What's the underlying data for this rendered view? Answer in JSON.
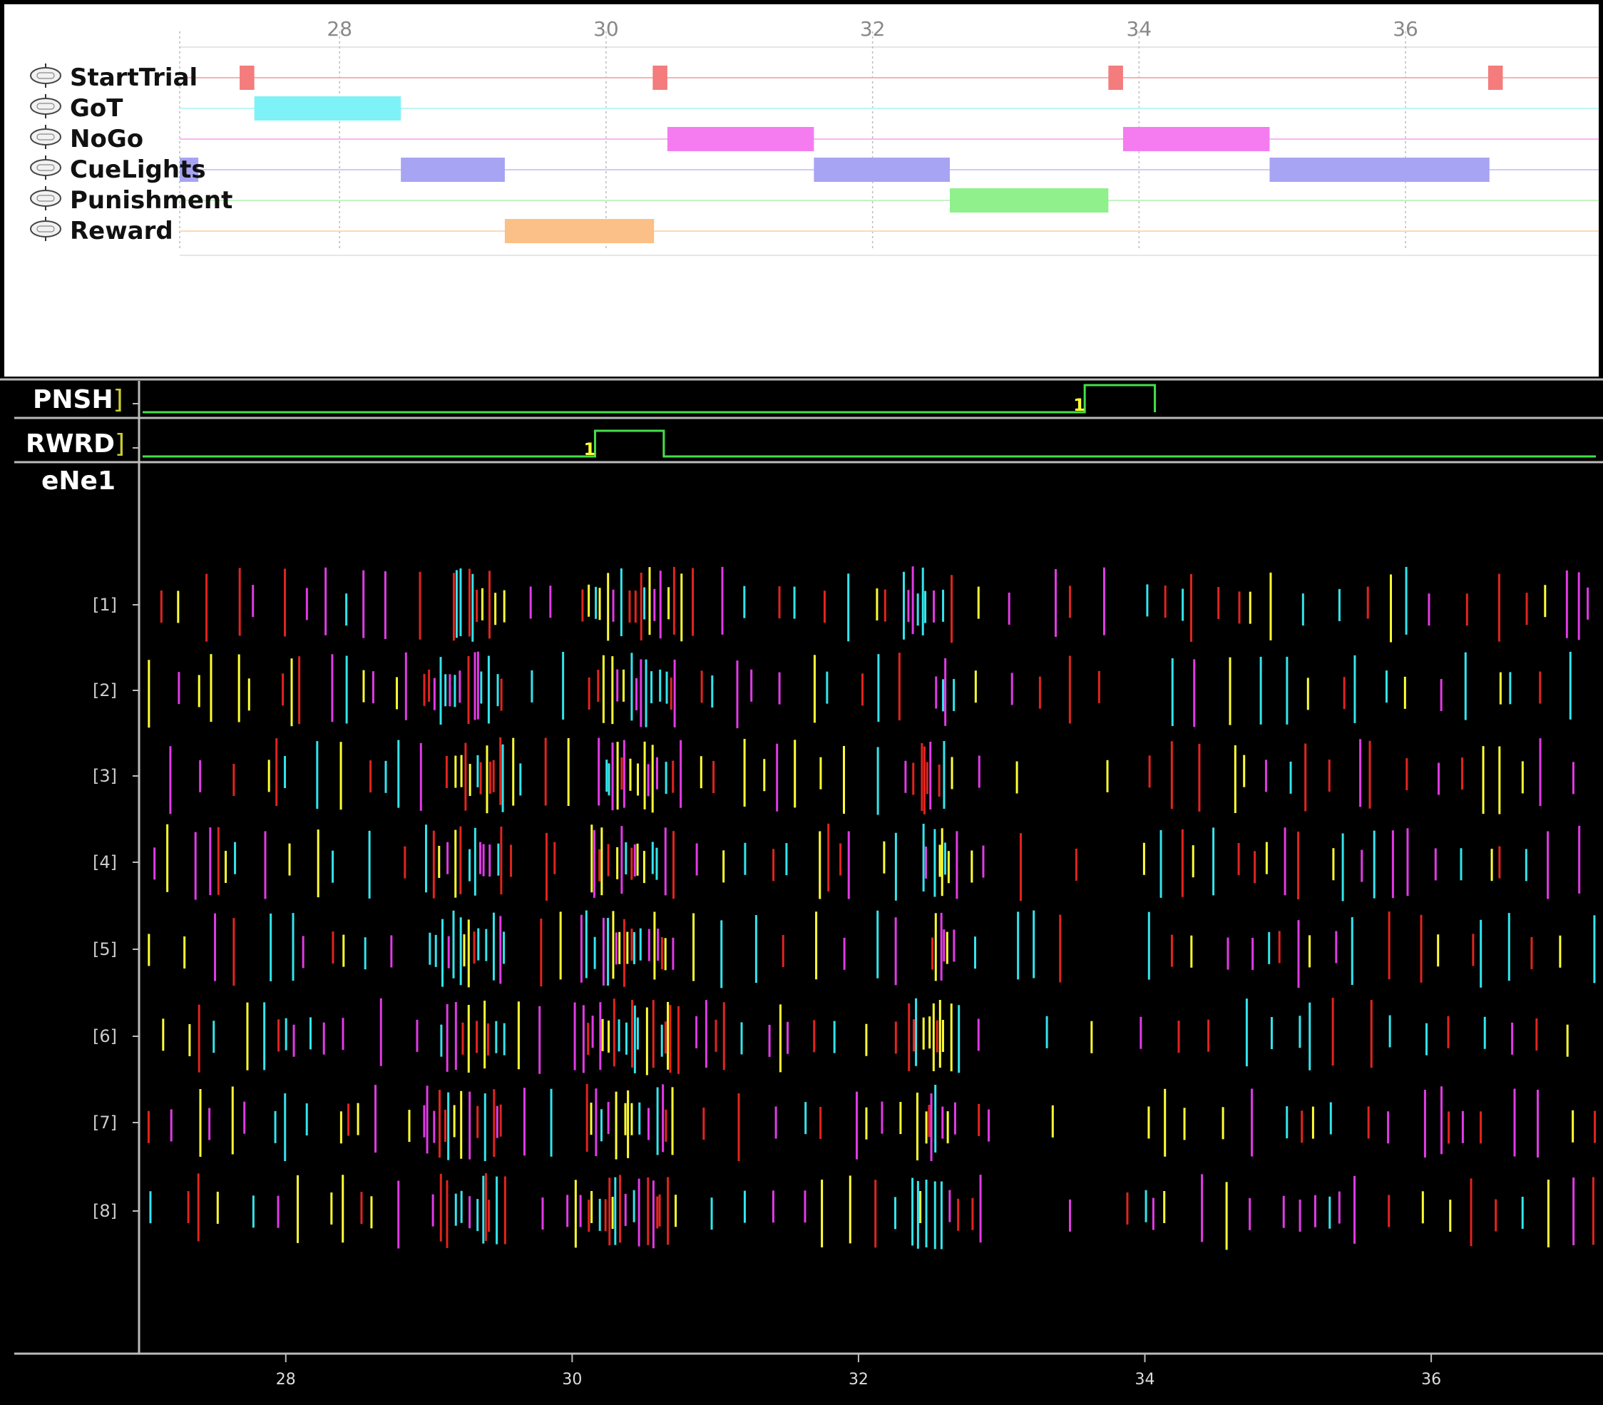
{
  "timeline": {
    "tick_labels": [
      "28",
      "30",
      "32",
      "34",
      "36"
    ],
    "tick_values": [
      28,
      30,
      32,
      34,
      36
    ],
    "x_range": [
      26.8,
      37.45
    ],
    "states": [
      {
        "name": "StartTrial",
        "color": "#f47c7c",
        "line_color": "#f5b3b3",
        "intervals": [
          [
            27.25,
            27.36
          ],
          [
            30.35,
            30.46
          ],
          [
            33.77,
            33.88
          ],
          [
            36.62,
            36.73
          ]
        ]
      },
      {
        "name": "GoT",
        "color": "#7ef2f6",
        "line_color": "#bff6f8",
        "intervals": [
          [
            27.36,
            28.46
          ]
        ]
      },
      {
        "name": "NoGo",
        "color": "#f57cf0",
        "line_color": "#f7b8f2",
        "intervals": [
          [
            30.46,
            31.56
          ],
          [
            33.88,
            34.98
          ]
        ]
      },
      {
        "name": "CueLights",
        "color": "#a7a4f4",
        "line_color": "#cfcdf8",
        "intervals": [
          [
            26.8,
            26.94
          ],
          [
            28.46,
            29.24
          ],
          [
            31.56,
            32.58
          ],
          [
            34.98,
            36.63
          ]
        ]
      },
      {
        "name": "Punishment",
        "color": "#8ff08c",
        "line_color": "#c4f5c3",
        "intervals": [
          [
            32.58,
            33.77
          ]
        ]
      },
      {
        "name": "Reward",
        "color": "#fbc087",
        "line_color": "#fbd9b8",
        "intervals": [
          [
            29.24,
            30.36
          ]
        ]
      }
    ]
  },
  "channels": [
    {
      "label": "PNSH",
      "bracket": "]",
      "pulse_label": "1",
      "trace_color": "#43e04a",
      "pulses": [
        [
          33.58,
          34.07
        ]
      ]
    },
    {
      "label": "RWRD",
      "bracket": "]",
      "pulse_label": "1",
      "trace_color": "#43e04a",
      "pulses": [
        [
          30.16,
          30.64
        ]
      ]
    }
  ],
  "raster": {
    "title": "eNe1",
    "trace_labels": [
      "[1]",
      "[2]",
      "[3]",
      "[4]",
      "[5]",
      "[6]",
      "[7]",
      "[8]"
    ],
    "tick_labels": [
      "28",
      "30",
      "32",
      "34",
      "36"
    ],
    "tick_values": [
      28,
      30,
      32,
      34,
      36
    ],
    "x_range": [
      27.0,
      37.15
    ],
    "unit_colors": [
      "#ffff33",
      "#33e5ee",
      "#e2241e",
      "#e23ae6"
    ]
  }
}
